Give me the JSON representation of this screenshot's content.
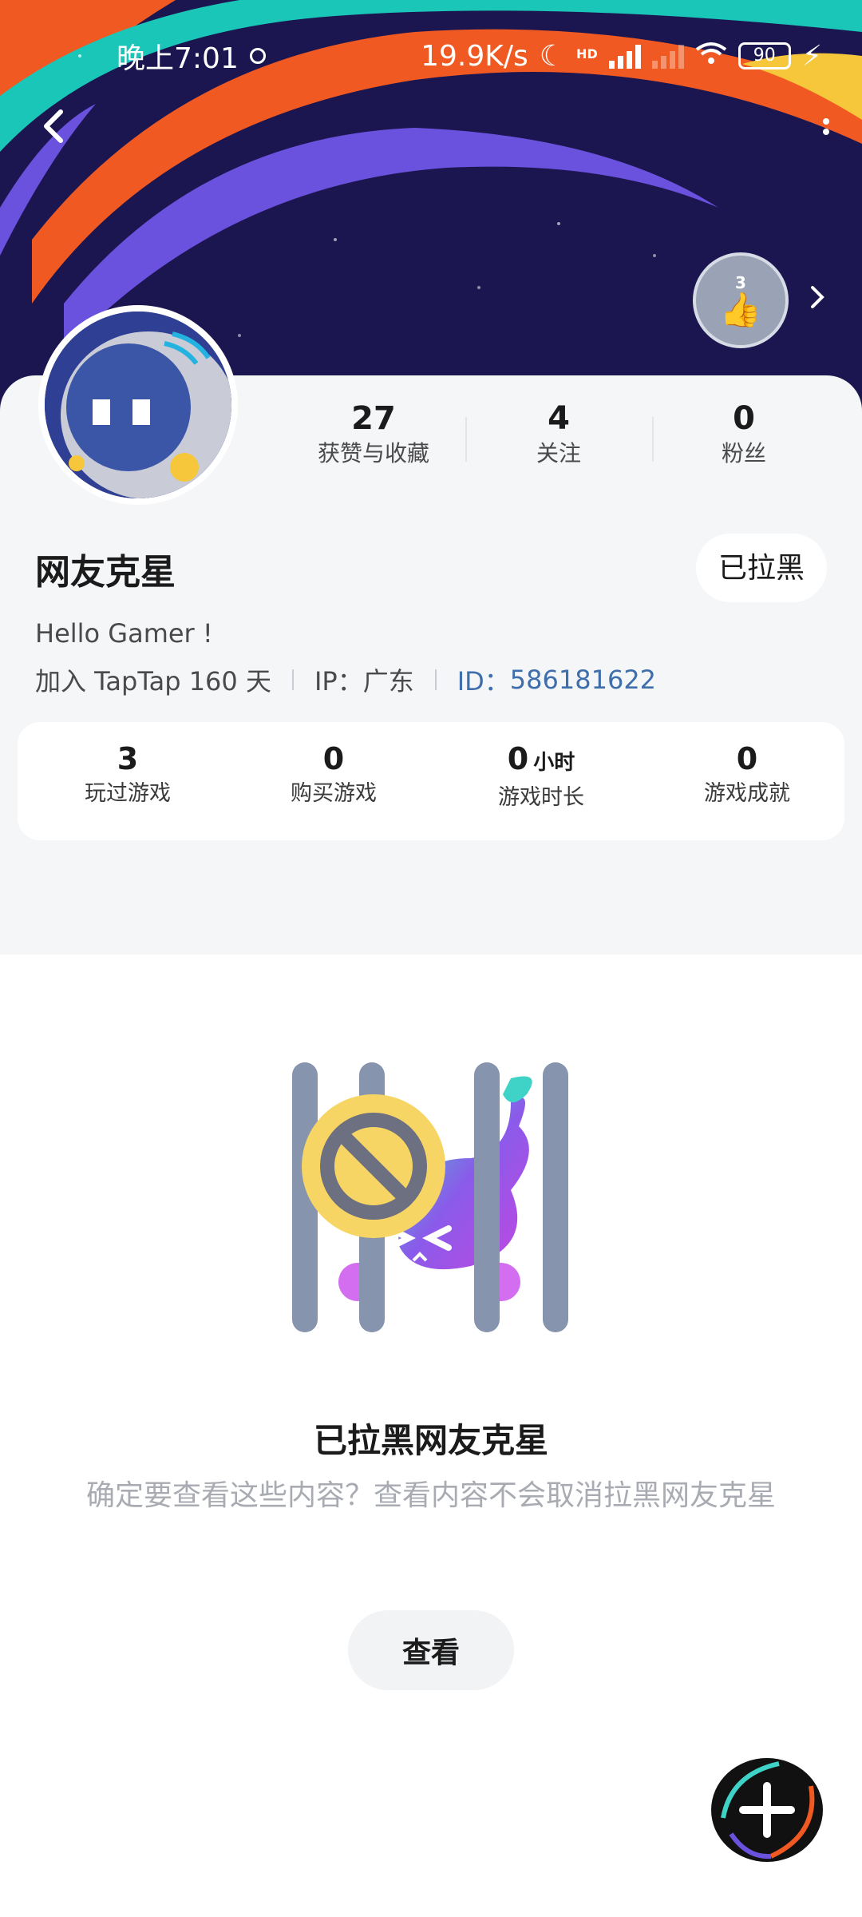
{
  "status_bar": {
    "time": "晚上7:01",
    "network_speed": "19.9K/s",
    "hd_label": "HD",
    "battery": "90"
  },
  "header": {
    "back_icon": "back-arrow-icon",
    "more_icon": "more-vertical-icon",
    "badge_count": "3"
  },
  "profile": {
    "stats": [
      {
        "value": "27",
        "label": "获赞与收藏"
      },
      {
        "value": "4",
        "label": "关注"
      },
      {
        "value": "0",
        "label": "粉丝"
      }
    ],
    "name": "网友克星",
    "blocked_label": "已拉黑",
    "bio": "Hello Gamer !",
    "joined": "加入 TapTap 160 天",
    "ip": "IP：广东",
    "id_label": "ID：",
    "id_value": "586181622"
  },
  "game_stats": [
    {
      "value": "3",
      "unit": "",
      "label": "玩过游戏"
    },
    {
      "value": "0",
      "unit": "",
      "label": "购买游戏"
    },
    {
      "value": "0",
      "unit": "小时",
      "label": "游戏时长"
    },
    {
      "value": "0",
      "unit": "",
      "label": "游戏成就"
    }
  ],
  "blocked_notice": {
    "title": "已拉黑网友克星",
    "description": "确定要查看这些内容？查看内容不会取消拉黑网友克星",
    "view_button": "查看"
  },
  "fab_icon": "plus-icon",
  "colors": {
    "accent_id": "#3e6eab",
    "hero_bg": "#1b1650",
    "page_bg": "#f5f6f8"
  }
}
